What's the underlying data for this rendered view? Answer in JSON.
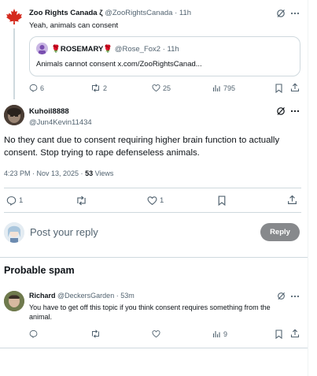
{
  "parent": {
    "name": "Zoo Rights Canada ζ",
    "handle": "@ZooRightsCanada",
    "time": "· 11h",
    "text": "Yeah, animals can consent",
    "quote": {
      "name": "🌹ROSEMARY🌹",
      "handle": "@Rose_Fox2",
      "time": "· 11h",
      "text": "Animals cannot consent x.com/ZooRightsCanad..."
    },
    "stats": {
      "replies": "6",
      "reposts": "2",
      "likes": "25",
      "views": "795"
    }
  },
  "main": {
    "name": "Kuhoil8888",
    "handle": "@Jun4Kevin11434",
    "text": "No they cant due to consent requiring higher brain function to actually consent. Stop trying to rape defenseless animals.",
    "timestamp": "4:23 PM · Nov 13, 2025 · ",
    "views_count": "53",
    "views_label": " Views",
    "stats": {
      "replies": "1",
      "reposts": "",
      "likes": "1"
    }
  },
  "reply_box": {
    "placeholder": "Post your reply",
    "button": "Reply"
  },
  "spam_section": {
    "heading": "Probable spam"
  },
  "spam_reply": {
    "name": "Richard",
    "handle": "@DeckersGarden",
    "time": "· 53m",
    "text": "You have to get off this topic if you think consent requires something from the animal.",
    "stats": {
      "views": "9"
    }
  },
  "colors": {
    "accent": "#1d9bf0",
    "reply_button_bg": "#87898c",
    "muted": "#536471"
  }
}
